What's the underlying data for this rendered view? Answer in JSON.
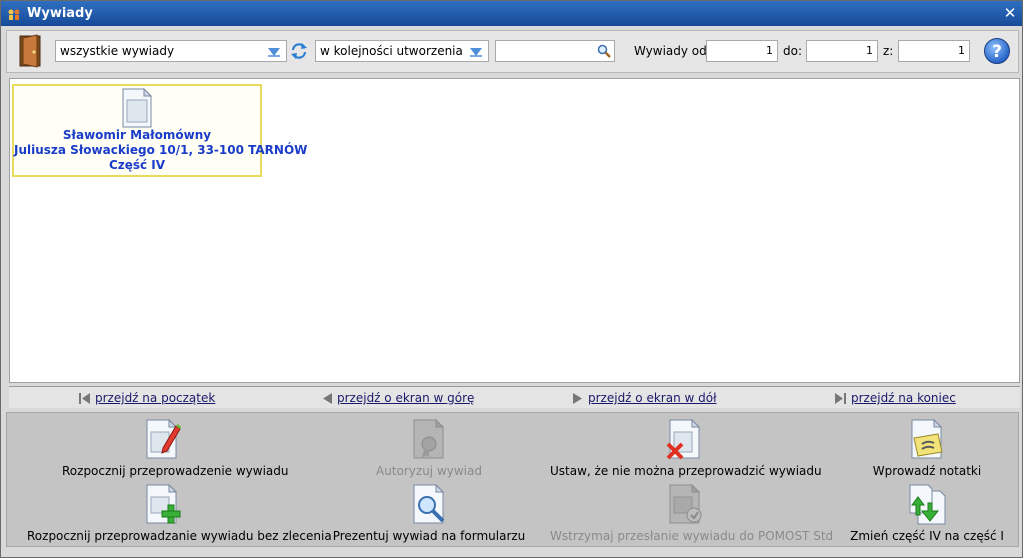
{
  "window": {
    "title": "Wywiady"
  },
  "toolbar": {
    "filter_value": "wszystkie wywiady",
    "sort_value": "w kolejności utworzenia",
    "search_value": "",
    "from_label": "Wywiady od:",
    "from_value": "1",
    "to_label": "do:",
    "to_value": "1",
    "of_label": "z:",
    "of_value": "1",
    "help_label": "?"
  },
  "interviews": [
    {
      "name": "Sławomir Małomówny",
      "address": "Juliusza Słowackiego 10/1, 33-100 TARNÓW",
      "part": "Część IV"
    }
  ],
  "navigation": {
    "first": "przejdź na początek",
    "up": "przejdź o ekran w górę",
    "down": "przejdź o ekran w dół",
    "last": "przejdź na koniec"
  },
  "actions": {
    "start": "Rozpocznij przeprowadzenie wywiadu",
    "authorize": "Autoryzuj wywiad",
    "cannot": "Ustaw, że nie można przeprowadzić wywiadu",
    "notes": "Wprowadź notatki",
    "start_no_order": "Rozpocznij przeprowadzanie wywiadu bez zlecenia",
    "present": "Prezentuj wywiad na formularzu",
    "hold": "Wstrzymaj przesłanie wywiadu do POMOST Std",
    "change_part": "Zmień część IV na część I"
  },
  "colors": {
    "title_bar": "#174a99",
    "card_border": "#e8da5c",
    "card_text": "#1a3cc8"
  }
}
